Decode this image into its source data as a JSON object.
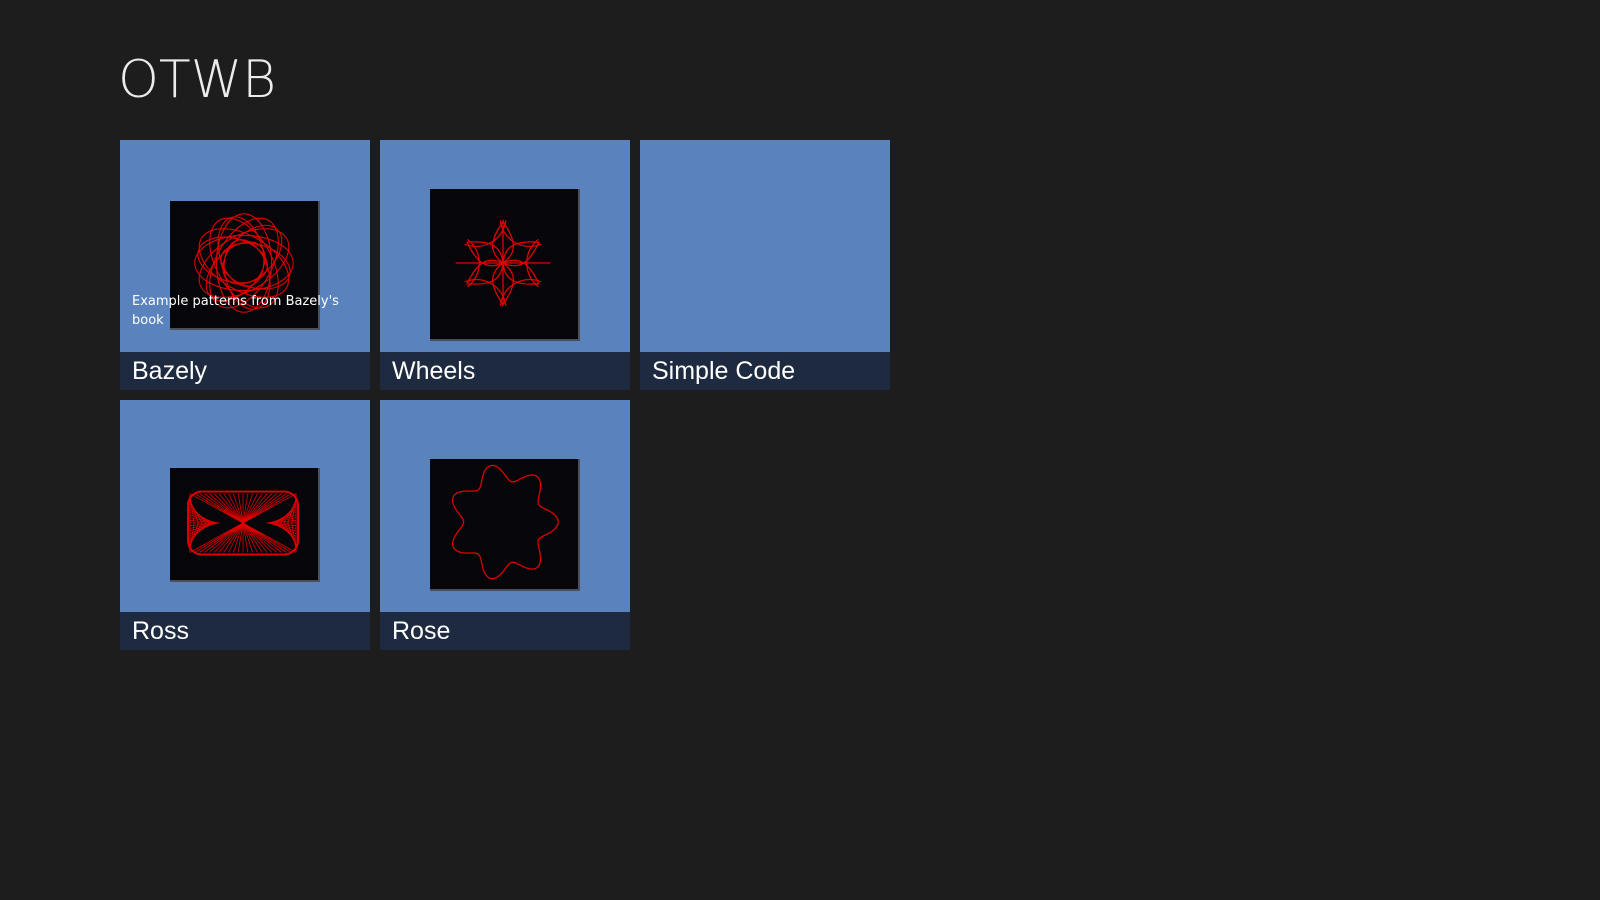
{
  "app": {
    "title": "OTWB"
  },
  "colors": {
    "background": "#1d1d1d",
    "tile": "#5a82bc",
    "caption_bar": "#1e2a40",
    "pattern": "#e00000"
  },
  "tiles": [
    {
      "label": "Bazely",
      "description": "Example patterns from Bazely's book",
      "thumbnail": "bazely-pattern-image"
    },
    {
      "label": "Wheels",
      "thumbnail": "wheels-pattern-image"
    },
    {
      "label": "Simple Code",
      "thumbnail": ""
    },
    {
      "label": "Ross",
      "thumbnail": "ross-pattern-image"
    },
    {
      "label": "Rose",
      "thumbnail": "rose-pattern-image"
    }
  ]
}
